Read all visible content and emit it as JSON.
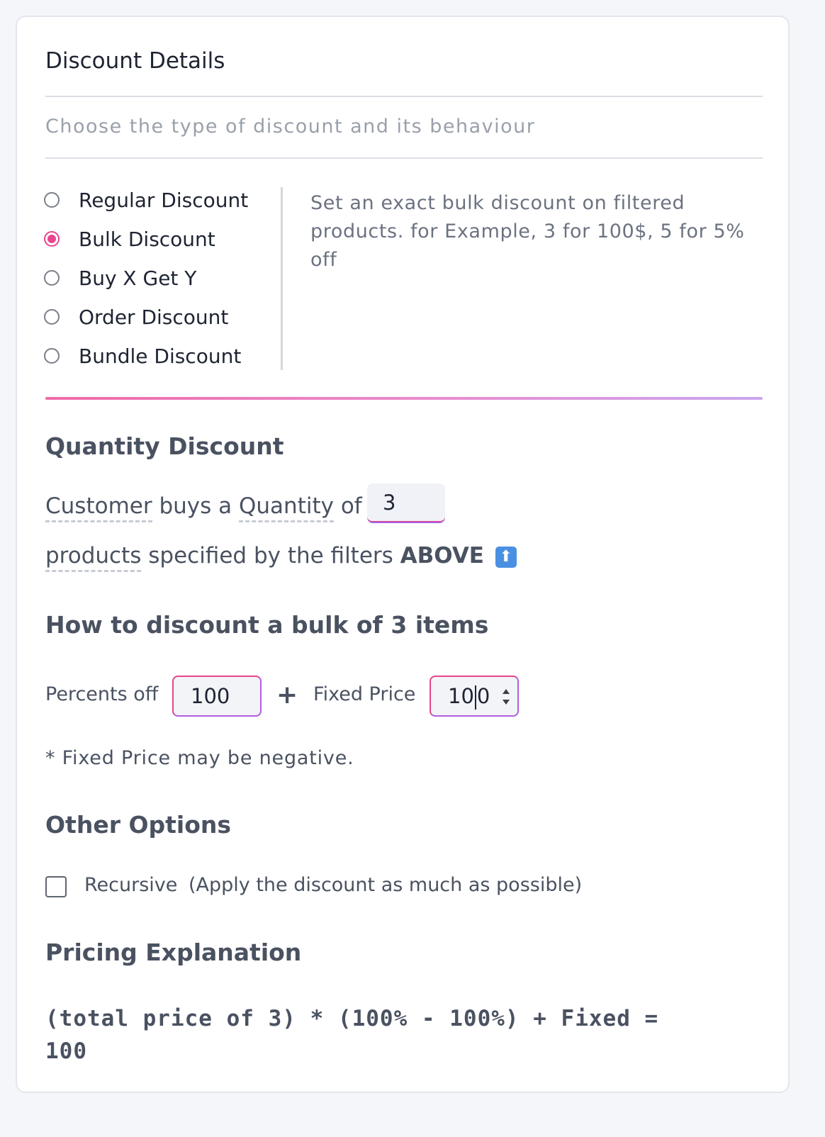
{
  "card": {
    "title": "Discount Details",
    "subtitle": "Choose the type of discount and its behaviour"
  },
  "discount_types": {
    "options": [
      {
        "label": "Regular Discount",
        "checked": false
      },
      {
        "label": "Bulk Discount",
        "checked": true
      },
      {
        "label": "Buy X Get Y",
        "checked": false
      },
      {
        "label": "Order Discount",
        "checked": false
      },
      {
        "label": "Bundle Discount",
        "checked": false
      }
    ],
    "description": "Set an exact bulk discount on filtered products. for Example, 3 for 100$, 5 for 5% off"
  },
  "colors": {
    "accent": "#e8458f",
    "accent_secondary": "#b05ee0",
    "text": "#4a5261",
    "muted": "#9aa0aa"
  },
  "quantity": {
    "heading": "Quantity Discount",
    "w_customer": "Customer",
    "w_buys_a": "buys a",
    "w_quantity": "Quantity",
    "w_of": "of",
    "value": "3",
    "w_products": "products",
    "w_specified": "specified by the filters",
    "w_above": "ABOVE",
    "above_icon": "up-arrow-icon"
  },
  "how": {
    "heading": "How to discount a bulk of 3 items",
    "percents_label": "Percents off",
    "percents_value": "100",
    "plus": "+",
    "fixed_label": "Fixed Price",
    "fixed_value_a": "10",
    "fixed_value_b": "0",
    "note": "* Fixed Price may be negative."
  },
  "other": {
    "heading": "Other Options",
    "recursive_label": "Recursive",
    "recursive_desc": "(Apply the discount as much as possible)",
    "recursive_checked": false
  },
  "pricing": {
    "heading": "Pricing Explanation",
    "formula_line1": "(total price of 3) * (100% - 100%) + Fixed =",
    "formula_line2": "100"
  }
}
